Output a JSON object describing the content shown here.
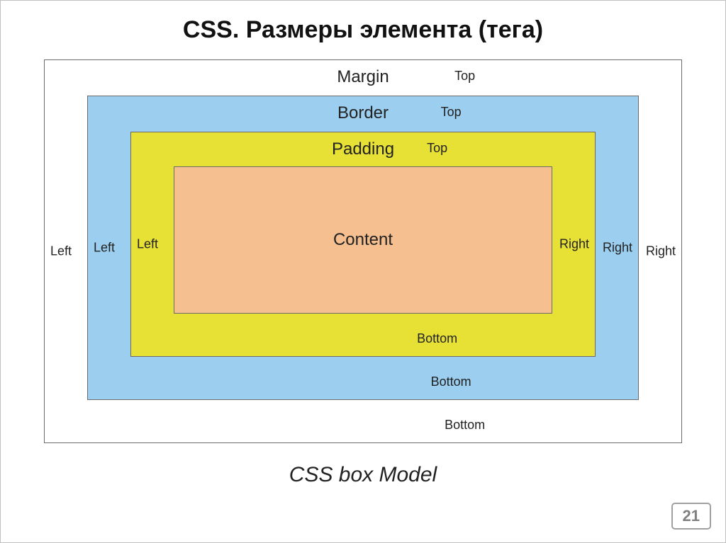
{
  "title": "CSS. Размеры элемента (тега)",
  "caption": "CSS box Model",
  "page_number": "21",
  "layers": {
    "margin": {
      "name": "Margin",
      "top": "Top",
      "bottom": "Bottom",
      "left": "Left",
      "right": "Right"
    },
    "border": {
      "name": "Border",
      "top": "Top",
      "bottom": "Bottom",
      "left": "Left",
      "right": "Right"
    },
    "padding": {
      "name": "Padding",
      "top": "Top",
      "bottom": "Bottom",
      "left": "Left",
      "right": "Right"
    },
    "content": {
      "name": "Content"
    }
  },
  "colors": {
    "margin_bg": "#ffffff",
    "border_bg": "#9cceef",
    "padding_bg": "#e7e135",
    "content_bg": "#f5bf8f"
  }
}
